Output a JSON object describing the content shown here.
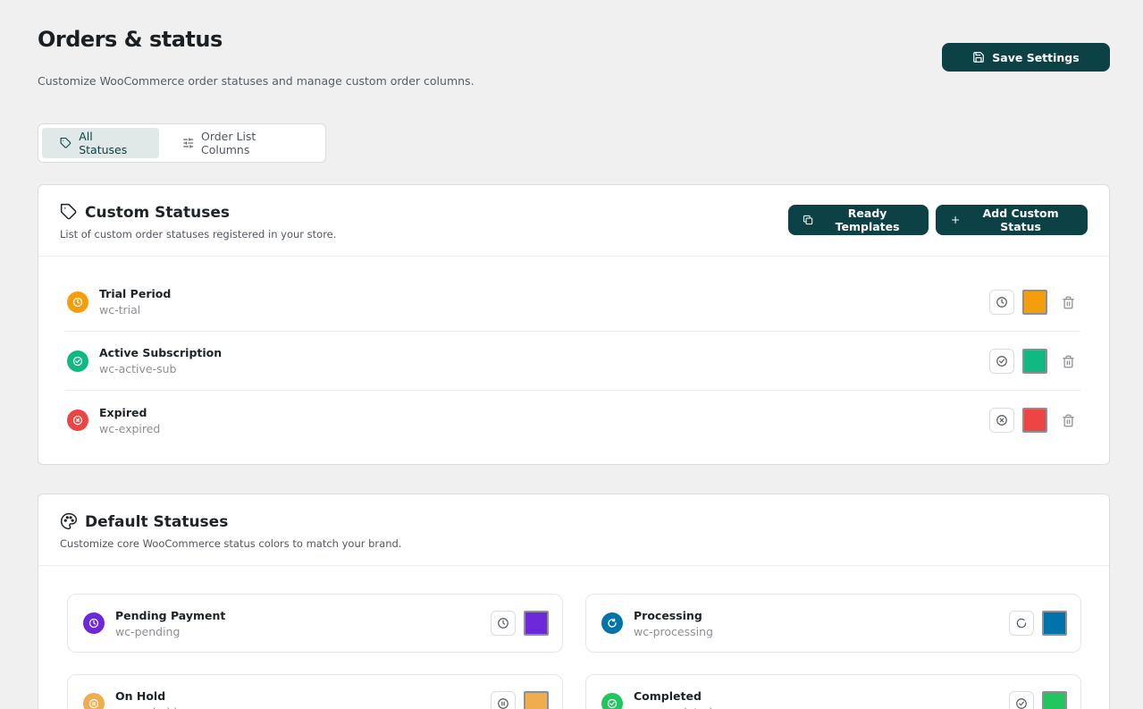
{
  "header": {
    "title": "Orders & status",
    "subtitle": "Customize WooCommerce order statuses and manage custom order columns.",
    "save_label": "Save Settings"
  },
  "tabs": [
    {
      "label": "All Statuses",
      "icon": "tag-icon",
      "active": true
    },
    {
      "label": "Order List Columns",
      "icon": "sliders-icon",
      "active": false
    }
  ],
  "custom_card": {
    "title": "Custom Statuses",
    "desc": "List of custom order statuses registered in your store.",
    "templates_label": "Ready Templates",
    "add_label": "Add Custom Status",
    "items": [
      {
        "name": "Trial Period",
        "slug": "wc-trial",
        "color": "#f59e0b",
        "icon": "clock-icon"
      },
      {
        "name": "Active Subscription",
        "slug": "wc-active-sub",
        "color": "#10b981",
        "icon": "check-circle-icon"
      },
      {
        "name": "Expired",
        "slug": "wc-expired",
        "color": "#ef4444",
        "icon": "x-circle-icon"
      }
    ]
  },
  "default_card": {
    "title": "Default Statuses",
    "desc": "Customize core WooCommerce status colors to match your brand.",
    "items": [
      {
        "name": "Pending Payment",
        "slug": "wc-pending",
        "color": "#6d28d9",
        "icon": "clock-icon"
      },
      {
        "name": "Processing",
        "slug": "wc-processing",
        "color": "#0073aa",
        "icon": "refresh-icon"
      },
      {
        "name": "On Hold",
        "slug": "wc-on-hold",
        "color": "#f0ad4e",
        "icon": "pause-circle-icon"
      },
      {
        "name": "Completed",
        "slug": "wc-completed",
        "color": "#22c55e",
        "icon": "check-circle-icon"
      }
    ]
  },
  "colors": {
    "primary": "#0c4145",
    "background": "#f0f0f0",
    "border": "#dcdcde"
  }
}
